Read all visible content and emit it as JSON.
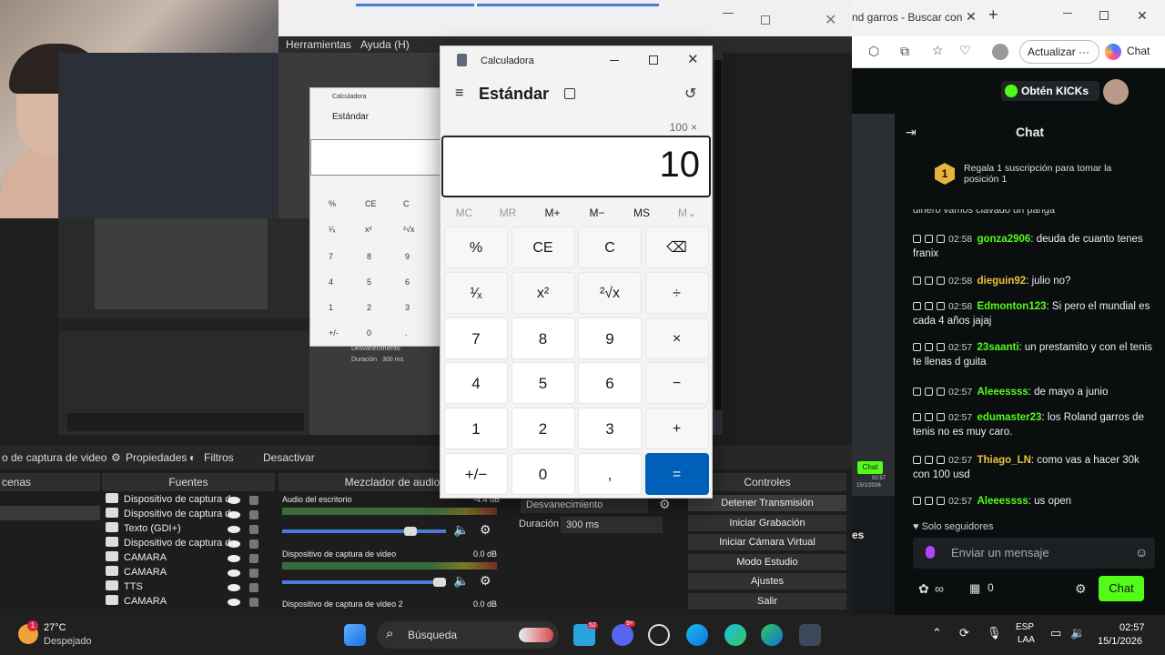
{
  "obs": {
    "menu": [
      "Herramientas",
      "Ayuda (H)"
    ],
    "toolbar": {
      "source_name": "o de captura de video",
      "properties": "Propiedades",
      "filters": "Filtros",
      "deactivate": "Desactivar"
    },
    "docks": {
      "scenes": "cenas",
      "sources": "Fuentes",
      "mixer": "Mezclador de audio",
      "transitions": "Desvanecimiento",
      "controls": "Controles"
    },
    "sources": [
      "Dispositivo de captura d",
      "Dispositivo de captura d",
      "Texto (GDI+)",
      "Dispositivo de captura d",
      "CAMARA",
      "CAMARA",
      "TTS",
      "CAMARA"
    ],
    "mixer": [
      {
        "label": "Audio del escritorio",
        "db": "-4.4 dB",
        "level": 0.6
      },
      {
        "label": "Dispositivo de captura de video",
        "db": "0.0 dB",
        "level": 0.78
      },
      {
        "label": "Dispositivo de captura de video 2",
        "db": "0.0 dB",
        "level": 0.0
      }
    ],
    "transition": {
      "name": "Desvanecimiento",
      "duration_label": "Duración",
      "duration": "300 ms"
    },
    "controls": [
      "Detener Transmisión",
      "Iniciar Grabación",
      "Iniciar Cámara Virtual",
      "Modo Estudio",
      "Ajustes",
      "Salir"
    ],
    "mini_calc": {
      "title": "Calculadora",
      "mode": "Estándar",
      "keys": [
        "%",
        "CE",
        "C",
        "¹⁄ₓ",
        "x²",
        "²√x",
        "7",
        "8",
        "9",
        "4",
        "5",
        "6",
        "1",
        "2",
        "3",
        "+/-",
        "0",
        "."
      ],
      "mini_panel": {
        "transition": "Desvanecimiento",
        "duration_label": "Duración",
        "duration": "300 ms"
      }
    }
  },
  "calculator": {
    "title": "Calculadora",
    "mode": "Estándar",
    "expression": "100 ×",
    "display": "10",
    "memory": [
      "MC",
      "MR",
      "M+",
      "M−",
      "MS",
      "M⌄"
    ],
    "keys": [
      [
        "%",
        "CE",
        "C",
        "⌫"
      ],
      [
        "¹⁄ₓ",
        "x²",
        "²√x",
        "÷"
      ],
      [
        "7",
        "8",
        "9",
        "×"
      ],
      [
        "4",
        "5",
        "6",
        "−"
      ],
      [
        "1",
        "2",
        "3",
        "+"
      ],
      [
        "+/−",
        "0",
        ",",
        "="
      ]
    ]
  },
  "browser": {
    "tab_title": "nd garros - Buscar con",
    "update_button": "Actualizar",
    "copilot": "Chat"
  },
  "kick": {
    "get_kicks": "Obtén KICKs",
    "chat_title": "Chat",
    "gift_banner": "Regala 1 suscripción para tomar la posición 1",
    "gift_rank": "1",
    "truncated_line": "dinero vamos clavado un panga",
    "messages": [
      {
        "time": "02:58",
        "user": "gonza2906",
        "color": "#53fc18",
        "text": "deuda de cuanto tenes franix"
      },
      {
        "time": "02:58",
        "user": "dieguin92",
        "color": "#e7c43b",
        "text": "julio no?"
      },
      {
        "time": "02:58",
        "user": "Edmonton123",
        "color": "#53fc18",
        "text": "Si pero el mundial es cada 4 años jajaj"
      },
      {
        "time": "02:57",
        "user": "23saanti",
        "color": "#53fc18",
        "text": "un prestamito y con el tenis te llenas d guita"
      },
      {
        "time": "02:57",
        "user": "Aleeessss",
        "color": "#53fc18",
        "text": "de mayo a junio"
      },
      {
        "time": "02:57",
        "user": "edumaster23",
        "color": "#53fc18",
        "text": "los Roland garros de tenis no es muy caro."
      },
      {
        "time": "02:57",
        "user": "Thiago_LN",
        "color": "#e7c43b",
        "text": "como vas a hacer 30k con 100 usd"
      },
      {
        "time": "02:57",
        "user": "Aleeessss",
        "color": "#53fc18",
        "text": "us open"
      }
    ],
    "followers_only": "Solo seguidores",
    "input_placeholder": "Enviar un mensaje",
    "infinity": "∞",
    "count": "0",
    "send": "Chat",
    "side_date": "15/1/2026",
    "side_time": "02:57",
    "side_chat": "Chat",
    "side_es": "es"
  },
  "taskbar": {
    "weather_temp": "27°C",
    "weather_desc": "Despejado",
    "weather_badge": "1",
    "search": "Búsqueda",
    "badge_telegram": "52",
    "badge_discord": "9+",
    "lang1": "ESP",
    "lang2": "LAA",
    "time": "02:57",
    "date": "15/1/2026"
  },
  "colors": {
    "kick_green": "#53fc18",
    "calc_accent": "#005fb8",
    "chat_bg": "#0b0e0f"
  }
}
